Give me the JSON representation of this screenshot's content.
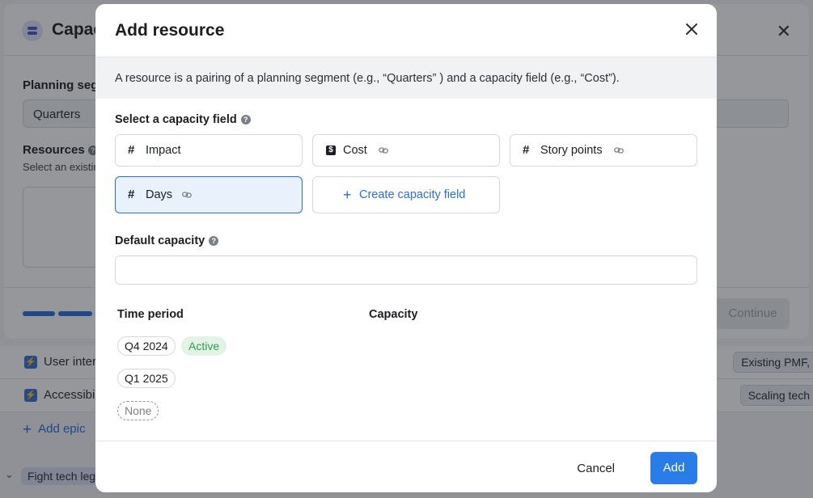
{
  "background": {
    "rows": [
      {
        "text": "User inter",
        "tag": "Existing PMF,"
      },
      {
        "text": "Accessibil",
        "tag": "Scaling tech"
      }
    ],
    "add_epic": "Add epic",
    "group_label": "Fight tech leg"
  },
  "underlying_modal": {
    "title": "Capac",
    "planning_segment_label": "Planning segm",
    "planning_segment_value": "Quarters",
    "resources_label": "Resources",
    "resources_sub": "Select an existin",
    "continue_label": "Continue"
  },
  "modal": {
    "title": "Add resource",
    "info": "A resource is a pairing of a planning segment (e.g., “Quarters” ) and a capacity field (e.g., “Cost”).",
    "select_field_label": "Select a capacity field",
    "fields": [
      {
        "name": "Impact",
        "icon": "hash-icon",
        "linked": false,
        "selected": false
      },
      {
        "name": "Cost",
        "icon": "dollar-icon",
        "linked": true,
        "selected": false
      },
      {
        "name": "Story points",
        "icon": "hash-icon",
        "linked": true,
        "selected": false
      },
      {
        "name": "Days",
        "icon": "hash-icon",
        "linked": true,
        "selected": true
      }
    ],
    "create_field_label": "Create capacity field",
    "default_capacity_label": "Default capacity",
    "default_capacity_value": "",
    "table": {
      "col_time_period": "Time period",
      "col_capacity": "Capacity",
      "periods": [
        {
          "label": "Q4 2024",
          "badge": "Active"
        },
        {
          "label": "Q1 2025",
          "badge": ""
        },
        {
          "label": "None",
          "badge": ""
        }
      ]
    },
    "cancel_label": "Cancel",
    "add_label": "Add"
  },
  "colors": {
    "accent": "#2a7de9",
    "selected_bg": "#e9f1fd",
    "active_badge_bg": "#e3f4e6",
    "active_badge_text": "#2f9e4f"
  }
}
